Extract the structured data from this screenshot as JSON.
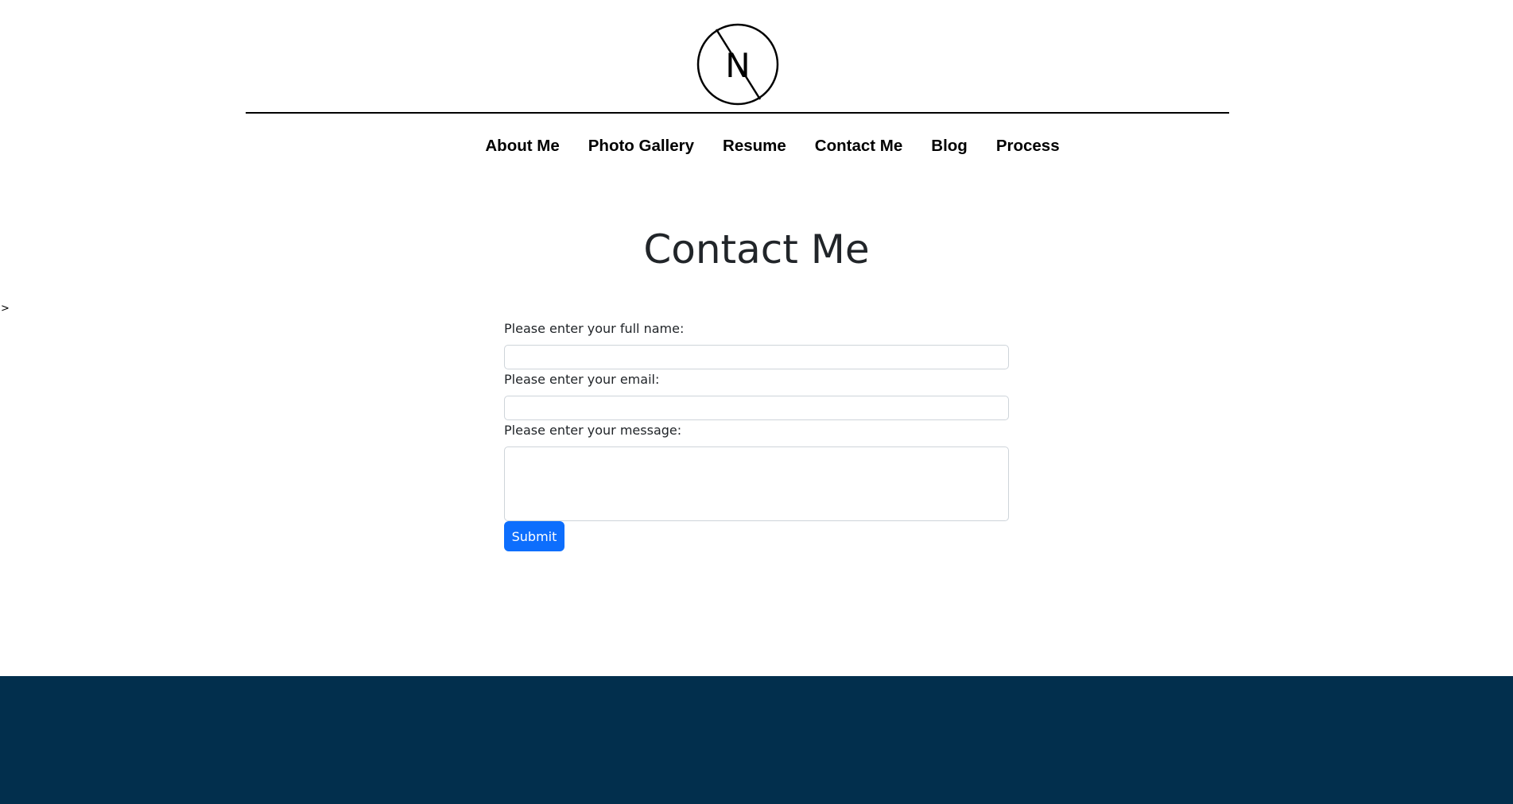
{
  "header": {
    "logo_letter": "N"
  },
  "nav": {
    "items": [
      {
        "label": "About Me"
      },
      {
        "label": "Photo Gallery"
      },
      {
        "label": "Resume"
      },
      {
        "label": "Contact Me"
      },
      {
        "label": "Blog"
      },
      {
        "label": "Process"
      }
    ]
  },
  "stray_text": ">",
  "main": {
    "title": "Contact Me",
    "form": {
      "name_label": "Please enter your full name:",
      "name_value": "",
      "email_label": "Please enter your email:",
      "email_value": "",
      "message_label": "Please enter your message:",
      "message_value": "",
      "submit_label": "Submit"
    }
  },
  "colors": {
    "submit_button": "#0d6efd",
    "footer_background": "#022f4d",
    "text": "#212529"
  },
  "icons": {
    "logo": "circle-n-monogram-icon"
  }
}
